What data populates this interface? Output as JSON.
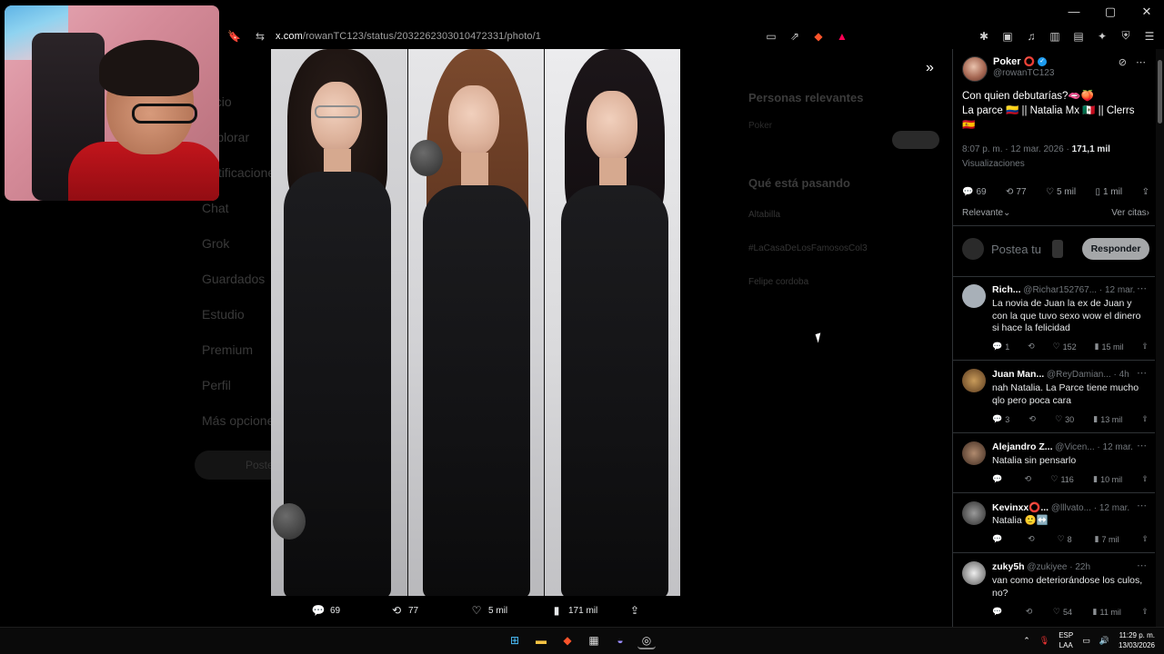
{
  "browser": {
    "url_host": "x.com",
    "url_path": "/rowanTC123/status/2032262303010472331/photo/1",
    "window_controls": [
      "—",
      "▢",
      "✕"
    ]
  },
  "background_nav": [
    "Inicio",
    "Explorar",
    "Notificaciones",
    "Chat",
    "Grok",
    "Guardados",
    "Estudio",
    "Premium",
    "Perfil",
    "Más opciones"
  ],
  "background_post_button": "Postear",
  "background_right": {
    "relevant_title": "Personas relevantes",
    "relevant_name": "Poker",
    "trending_title": "Qué está pasando",
    "trends": [
      "Altabilla",
      "#LaCasaDeLosFamososCol3",
      "Felipe cordoba"
    ]
  },
  "photo_actions": {
    "replies": "69",
    "reposts": "77",
    "likes": "5 mil",
    "views": "171 mil"
  },
  "tweet": {
    "author_name": "Poker",
    "author_handle": "@rowanTC123",
    "text_line1": "Con quien debutarías?🫦🍑",
    "text_line2": "La parce 🇨🇴 || Natalia Mx 🇲🇽 || Clerrs 🇪🇸",
    "time": "8:07 p. m. · 12 mar. 2026 · ",
    "views": "171,1 mil",
    "views_label": "Visualizaciones",
    "replies": "69",
    "reposts": "77",
    "likes": "5 mil",
    "bookmarks": "1 mil",
    "sort": "Relevante",
    "quotes": "Ver citas",
    "reply_placeholder": "Postea tu",
    "reply_button": "Responder"
  },
  "comments": [
    {
      "name": "Rich...",
      "handle": "@Richar152767...",
      "time": "· 12 mar.",
      "text": "La novia de Juan la ex de Juan y con la que tuvo sexo wow el dinero si hace la felicidad",
      "replies": "1",
      "likes": "152",
      "views": "15 mil"
    },
    {
      "name": "Juan Man...",
      "handle": "@ReyDamian...",
      "time": "· 4h",
      "text": "nah Natalia. La Parce tiene mucho qlo pero poca cara",
      "replies": "3",
      "likes": "30",
      "views": "13 mil"
    },
    {
      "name": "Alejandro Z...",
      "handle": "@Vicen...",
      "time": "· 12 mar.",
      "text": "Natalia sin pensarlo",
      "replies": "",
      "likes": "116",
      "views": "10 mil"
    },
    {
      "name": "Kevinxx⭕...",
      "handle": "@lllvato...",
      "time": "· 12 mar.",
      "text": "Natalia 🙂↔️",
      "replies": "",
      "likes": "8",
      "views": "7 mil"
    },
    {
      "name": "zuky5h",
      "handle": "@zukiyee",
      "time": "· 22h",
      "text": "van como deteriorándose los culos, no?",
      "replies": "",
      "likes": "54",
      "views": "11 mil"
    }
  ],
  "taskbar": {
    "lang_top": "ESP",
    "lang_bottom": "LAA",
    "time": "11:29 p. m.",
    "date": "13/03/2026"
  },
  "colors": {
    "accent": "#1d9bf0",
    "brave": "#fb542b",
    "background": "#000000"
  }
}
